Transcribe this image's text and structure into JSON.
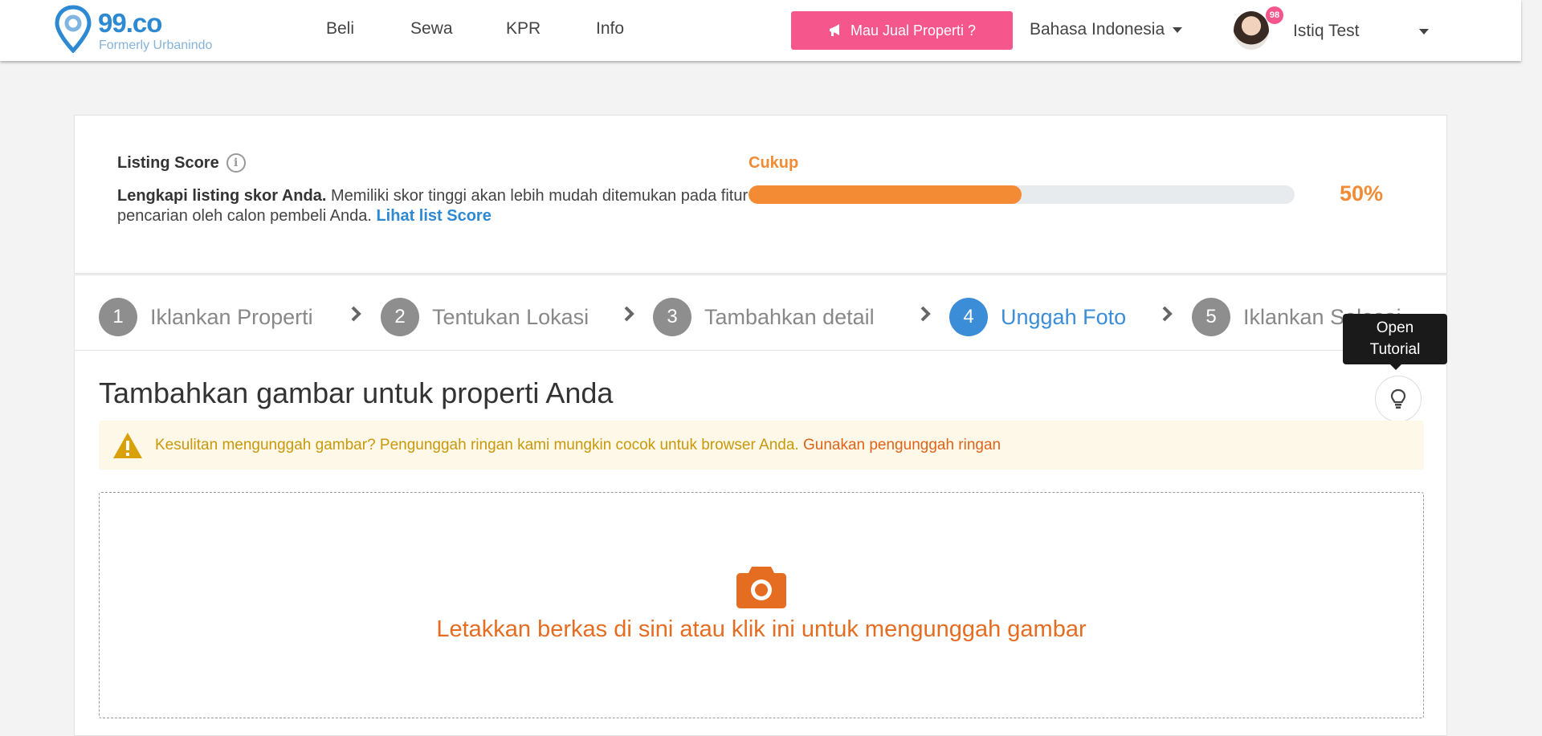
{
  "header": {
    "logo_name": "99.co",
    "logo_sub": "Formerly Urbanindo",
    "nav": [
      "Beli",
      "Sewa",
      "KPR",
      "Info"
    ],
    "sell_button": "Mau Jual Properti ?",
    "language": "Bahasa Indonesia",
    "notification_count": "98",
    "user_name": "Istiq Test"
  },
  "score": {
    "title": "Listing Score",
    "desc_bold": "Lengkapi listing skor Anda.",
    "desc_rest": " Memiliki skor tinggi akan lebih mudah ditemukan pada fitur pencarian oleh calon pembeli Anda. ",
    "link": "Lihat list Score",
    "level": "Cukup",
    "percent_text": "50%",
    "progress_fraction": 0.5
  },
  "steps": [
    {
      "num": "1",
      "label": "Iklankan Properti",
      "active": false
    },
    {
      "num": "2",
      "label": "Tentukan Lokasi",
      "active": false
    },
    {
      "num": "3",
      "label": "Tambahkan detail",
      "active": false
    },
    {
      "num": "4",
      "label": "Unggah Foto",
      "active": true
    },
    {
      "num": "5",
      "label": "Iklankan Selesai",
      "active": false
    }
  ],
  "main": {
    "title": "Tambahkan gambar untuk properti Anda",
    "tooltip": "Open Tutorial",
    "warning_text": "Kesulitan mengunggah gambar? Pengunggah ringan kami mungkin cocok untuk browser Anda.",
    "warning_link": "Gunakan pengunggah ringan",
    "drop_text": "Letakkan berkas di sini atau klik ini untuk mengunggah gambar"
  },
  "colors": {
    "brand_blue": "#2d89d1",
    "accent_pink": "#f5578c",
    "score_orange": "#f38b35",
    "upload_orange": "#e56d22"
  },
  "icons": [
    "map-pin-logo-icon",
    "megaphone-icon",
    "caret-down-icon",
    "info-icon",
    "chevron-right-icon",
    "lightbulb-icon",
    "warning-icon",
    "camera-icon"
  ]
}
